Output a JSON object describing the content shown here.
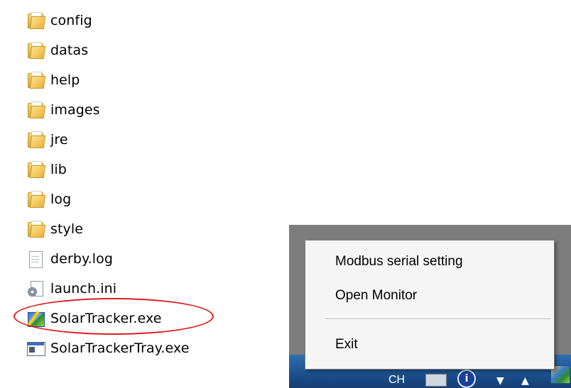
{
  "files": [
    {
      "name": "config",
      "type": "folder"
    },
    {
      "name": "datas",
      "type": "folder"
    },
    {
      "name": "help",
      "type": "folder"
    },
    {
      "name": "images",
      "type": "folder"
    },
    {
      "name": "jre",
      "type": "folder"
    },
    {
      "name": "lib",
      "type": "folder"
    },
    {
      "name": "log",
      "type": "folder"
    },
    {
      "name": "style",
      "type": "folder"
    },
    {
      "name": "derby.log",
      "type": "document"
    },
    {
      "name": "launch.ini",
      "type": "settings"
    },
    {
      "name": "SolarTracker.exe",
      "type": "solar-app",
      "highlighted": true
    },
    {
      "name": "SolarTrackerTray.exe",
      "type": "window-app"
    }
  ],
  "highlight_color": "#e01b1b",
  "context_menu": {
    "items": [
      {
        "label": "Modbus serial setting"
      },
      {
        "label": "Open Monitor"
      },
      {
        "label": "Exit"
      }
    ]
  },
  "taskbar": {
    "lang_text": "CH",
    "info_symbol": "i",
    "down_arrow": "▼",
    "up_arrow": "▲"
  }
}
